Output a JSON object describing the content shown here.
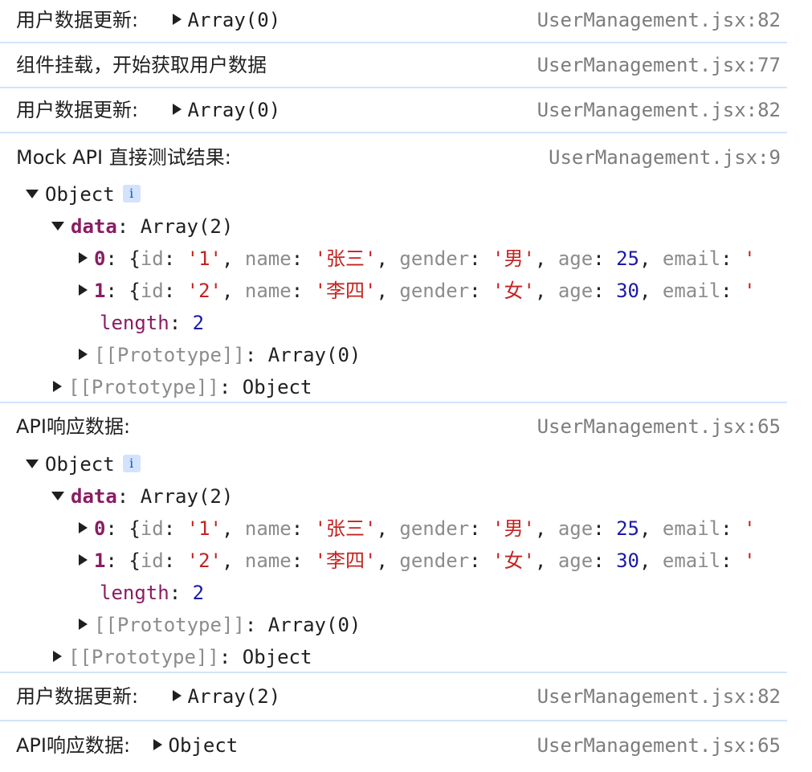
{
  "logs": {
    "m1": {
      "label": "用户数据更新:",
      "value": "Array(0)",
      "source": "UserManagement.jsx:82"
    },
    "m2": {
      "label": "组件挂载，开始获取用户数据",
      "source": "UserManagement.jsx:77"
    },
    "m3": {
      "label": "用户数据更新:",
      "value": "Array(0)",
      "source": "UserManagement.jsx:82"
    },
    "m4": {
      "label": "Mock API 直接测试结果:",
      "source": "UserManagement.jsx:9",
      "object_label": "Object",
      "info": "i",
      "data_key": "data",
      "data_value": "Array(2)",
      "item0": {
        "index": "0",
        "id": "'1'",
        "name": "'张三'",
        "gender": "'男'",
        "age": "25"
      },
      "item1": {
        "index": "1",
        "id": "'2'",
        "name": "'李四'",
        "gender": "'女'",
        "age": "30"
      },
      "length_key": "length",
      "length_value": "2",
      "proto_key": "[[Prototype]]",
      "proto_array": "Array(0)",
      "proto_object": "Object"
    },
    "m5": {
      "label": "API响应数据:",
      "source": "UserManagement.jsx:65",
      "object_label": "Object",
      "info": "i",
      "data_key": "data",
      "data_value": "Array(2)",
      "item0": {
        "index": "0",
        "id": "'1'",
        "name": "'张三'",
        "gender": "'男'",
        "age": "25"
      },
      "item1": {
        "index": "1",
        "id": "'2'",
        "name": "'李四'",
        "gender": "'女'",
        "age": "30"
      },
      "length_key": "length",
      "length_value": "2",
      "proto_key": "[[Prototype]]",
      "proto_array": "Array(0)",
      "proto_object": "Object"
    },
    "m6": {
      "label": "用户数据更新:",
      "value": "Array(2)",
      "source": "UserManagement.jsx:82"
    },
    "m7": {
      "label": "API响应数据:",
      "value": "Object",
      "source": "UserManagement.jsx:65"
    }
  },
  "keys": {
    "id": "id",
    "name": "name",
    "gender": "gender",
    "age": "age",
    "email": "email",
    "email_open": "'"
  }
}
